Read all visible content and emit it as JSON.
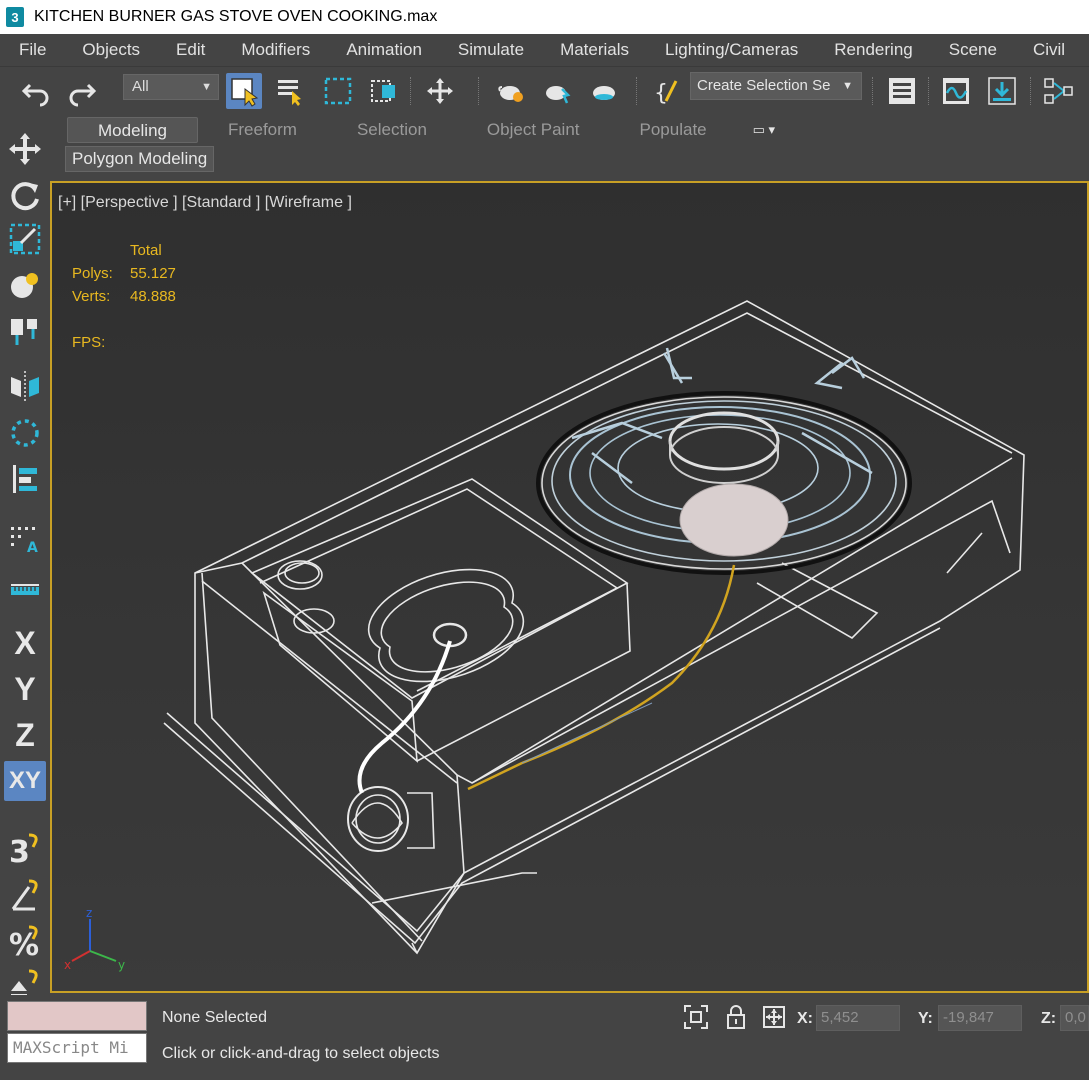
{
  "window": {
    "title": "KITCHEN BURNER GAS STOVE OVEN COOKING.max",
    "app_icon": "3"
  },
  "menu": [
    "File",
    "Objects",
    "Edit",
    "Modifiers",
    "Animation",
    "Simulate",
    "Materials",
    "Lighting/Cameras",
    "Rendering",
    "Scene",
    "Civil"
  ],
  "toolbar": {
    "filter_value": "All",
    "selection_set_placeholder": "Create Selection Se",
    "icons": [
      "undo-icon",
      "redo-icon",
      "select-object-icon",
      "select-by-name-icon",
      "rectangular-selection-icon",
      "window-crossing-icon",
      "move-icon",
      "render-setup-icon",
      "render-frame-icon",
      "render-icon",
      "scripting-icon",
      "layer-explorer-icon",
      "curve-editor-icon",
      "schematic-view-icon",
      "align-icon"
    ]
  },
  "ribbon": {
    "tabs": [
      "Modeling",
      "Freeform",
      "Selection",
      "Object Paint",
      "Populate"
    ],
    "active_tab": "Modeling",
    "panel": "Polygon Modeling"
  },
  "left_strip": {
    "axes": [
      "X",
      "Y",
      "Z",
      "XY"
    ],
    "active_axis": "XY"
  },
  "viewport": {
    "label": "[+] [Perspective ] [Standard ] [Wireframe ]",
    "stats": {
      "header": "Total",
      "polys_label": "Polys:",
      "polys": "55.127",
      "verts_label": "Verts:",
      "verts": "48.888",
      "fps_label": "FPS:"
    },
    "border_color": "#c8a025",
    "gizmo": {
      "x": "x",
      "y": "y",
      "z": "z"
    }
  },
  "status": {
    "selection": "None Selected",
    "prompt": "Click or click-and-drag to select objects",
    "maxscript_placeholder": "MAXScript Mi",
    "x_label": "X:",
    "x_value": "5,452",
    "y_label": "Y:",
    "y_value": "-19,847",
    "z_label": "Z:",
    "z_value": "0,0"
  }
}
